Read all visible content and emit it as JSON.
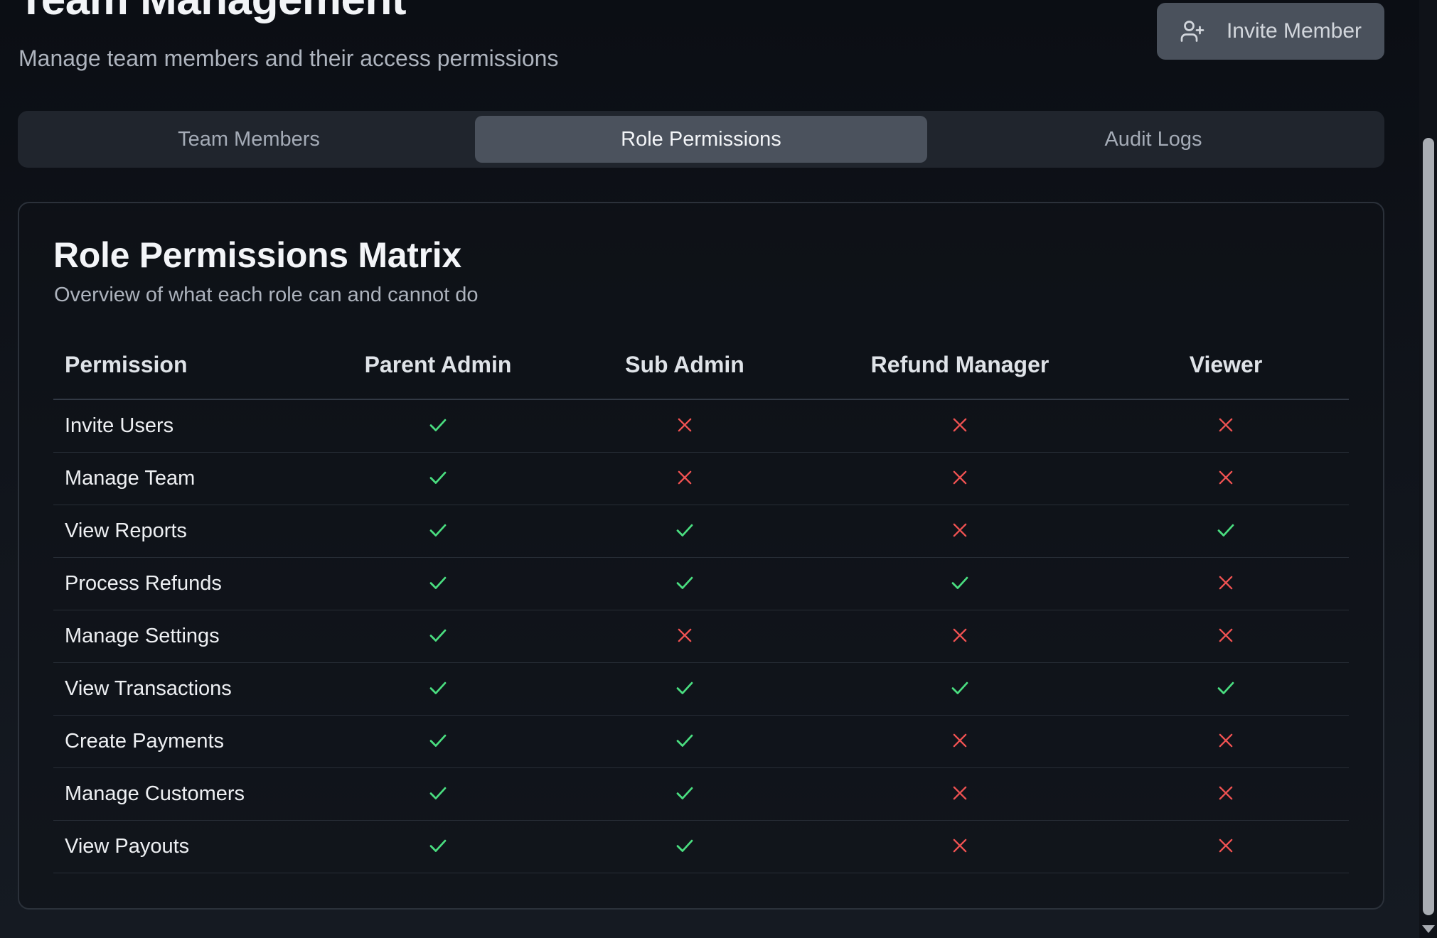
{
  "header": {
    "title": "Team Management",
    "subtitle": "Manage team members and their access permissions",
    "invite_button": {
      "label": "Invite Member",
      "icon": "user-plus-icon"
    }
  },
  "tabs": [
    {
      "label": "Team Members",
      "active": false
    },
    {
      "label": "Role Permissions",
      "active": true
    },
    {
      "label": "Audit Logs",
      "active": false
    }
  ],
  "card": {
    "title": "Role Permissions Matrix",
    "subtitle": "Overview of what each role can and cannot do"
  },
  "matrix": {
    "columns": [
      "Permission",
      "Parent Admin",
      "Sub Admin",
      "Refund Manager",
      "Viewer"
    ],
    "rows": [
      {
        "permission": "Invite Users",
        "values": [
          true,
          false,
          false,
          false
        ]
      },
      {
        "permission": "Manage Team",
        "values": [
          true,
          false,
          false,
          false
        ]
      },
      {
        "permission": "View Reports",
        "values": [
          true,
          true,
          false,
          true
        ]
      },
      {
        "permission": "Process Refunds",
        "values": [
          true,
          true,
          true,
          false
        ]
      },
      {
        "permission": "Manage Settings",
        "values": [
          true,
          false,
          false,
          false
        ]
      },
      {
        "permission": "View Transactions",
        "values": [
          true,
          true,
          true,
          true
        ]
      },
      {
        "permission": "Create Payments",
        "values": [
          true,
          true,
          false,
          false
        ]
      },
      {
        "permission": "Manage Customers",
        "values": [
          true,
          true,
          false,
          false
        ]
      },
      {
        "permission": "View Payouts",
        "values": [
          true,
          true,
          false,
          false
        ]
      }
    ],
    "icons": {
      "allowed": "check-icon",
      "denied": "x-icon"
    }
  },
  "colors": {
    "allowed": "#4ade80",
    "denied": "#f05252",
    "active_tab": "#4b525d",
    "button": "#4a515c"
  }
}
